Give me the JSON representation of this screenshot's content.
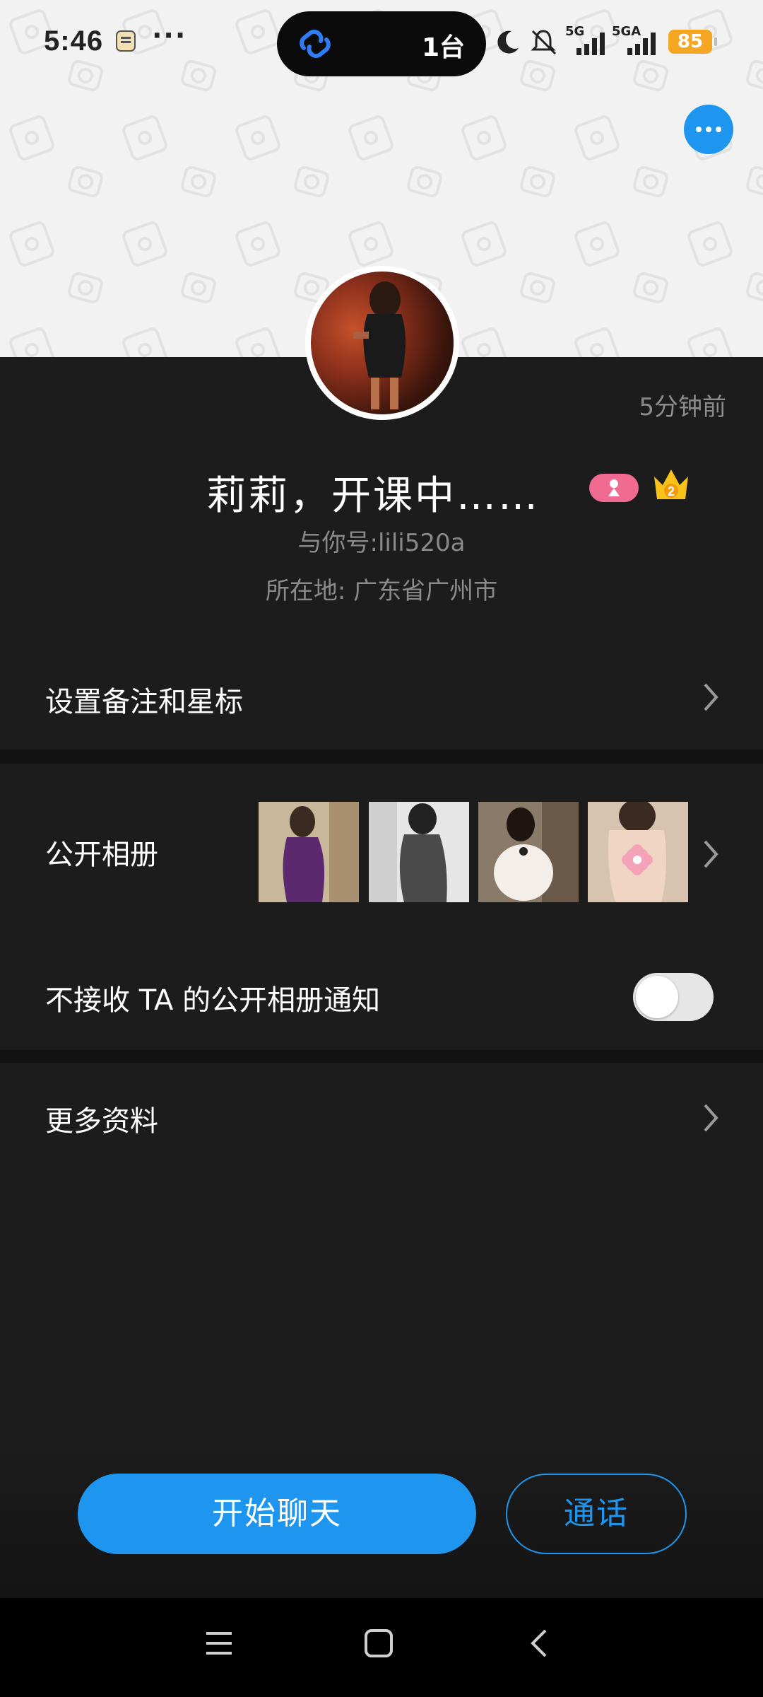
{
  "status_bar": {
    "time": "5:46",
    "more": "···",
    "island_count": "1台",
    "signal_1": "5G",
    "signal_2": "5GA",
    "battery": "85"
  },
  "profile": {
    "time_ago": "5分钟前",
    "name": "莉莉，开课中……",
    "wechat_id": "与你号:lili520a",
    "location": "所在地: 广东省广州市",
    "crown_level": "2"
  },
  "menu": {
    "remark": "设置备注和星标",
    "album": "公开相册",
    "album_notify": "不接收 TA 的公开相册通知",
    "more_info": "更多资料"
  },
  "actions": {
    "chat": "开始聊天",
    "call": "通话"
  },
  "colors": {
    "accent": "#1e96f0",
    "background": "#1c1c1c",
    "battery": "#f5a623"
  },
  "toggle_album_notify": false
}
